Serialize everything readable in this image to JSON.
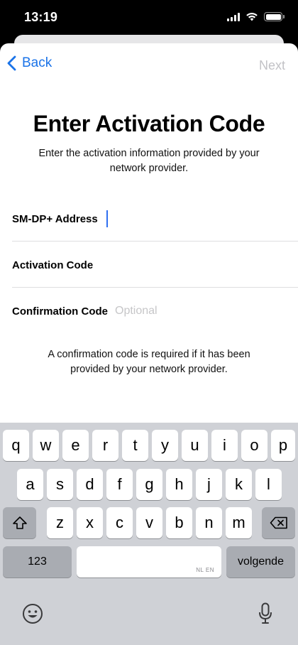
{
  "status_bar": {
    "time": "13:19",
    "icons": [
      "signal-icon",
      "wifi-icon",
      "battery-icon"
    ]
  },
  "nav": {
    "back_label": "Back",
    "next_label": "Next"
  },
  "page": {
    "title": "Enter Activation Code",
    "subtitle": "Enter the activation information provided by your network provider."
  },
  "form": {
    "smdp_label": "SM-DP+ Address",
    "smdp_value": "",
    "activation_label": "Activation Code",
    "activation_value": "",
    "confirmation_label": "Confirmation Code",
    "confirmation_placeholder": "Optional"
  },
  "note": "A confirmation code is required if it has been provided by your network provider.",
  "keyboard": {
    "row1": [
      "q",
      "w",
      "e",
      "r",
      "t",
      "y",
      "u",
      "i",
      "o",
      "p"
    ],
    "row2": [
      "a",
      "s",
      "d",
      "f",
      "g",
      "h",
      "j",
      "k",
      "l"
    ],
    "row3": [
      "z",
      "x",
      "c",
      "v",
      "b",
      "n",
      "m"
    ],
    "numbers_label": "123",
    "return_label": "volgende",
    "space_languages": "NL EN"
  },
  "colors": {
    "accent": "#1a73e8",
    "cursor": "#2f6ff0",
    "disabled": "#c2c2c6",
    "keyboard_bg": "#cfd1d6"
  }
}
